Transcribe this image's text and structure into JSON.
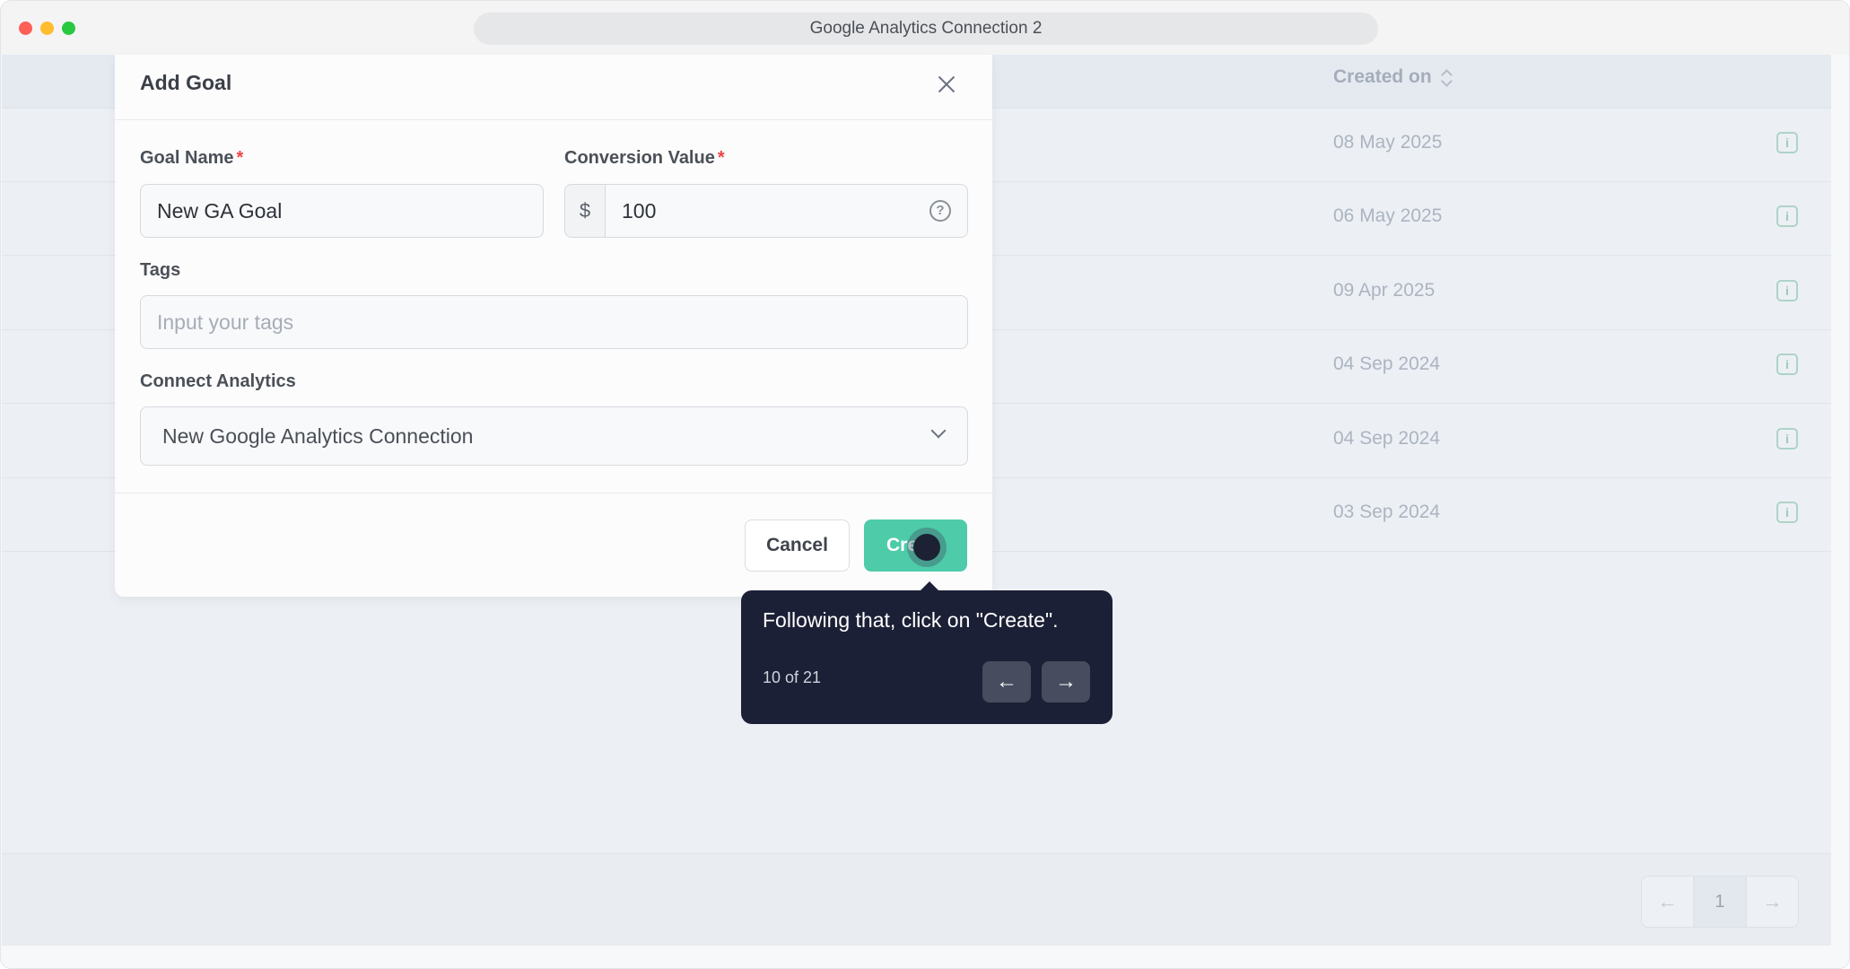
{
  "window": {
    "title": "Google Analytics Connection 2"
  },
  "table": {
    "created_header": "Created on",
    "rows": [
      {
        "date": "08 May 2025"
      },
      {
        "date": "06 May 2025"
      },
      {
        "date": "09 Apr 2025"
      },
      {
        "date": "04 Sep 2024"
      },
      {
        "date": "04 Sep 2024"
      },
      {
        "date": "03 Sep 2024"
      }
    ],
    "info_icon": "info-icon"
  },
  "pagination": {
    "prev": "←",
    "page": "1",
    "next": "→"
  },
  "modal": {
    "title": "Add Goal",
    "goal_name": {
      "label": "Goal Name",
      "required": "*",
      "value": "New GA Goal"
    },
    "conversion_value": {
      "label": "Conversion Value",
      "required": "*",
      "prefix": "$",
      "value": "100",
      "help_icon": "?"
    },
    "tags": {
      "label": "Tags",
      "placeholder": "Input your tags"
    },
    "connect_analytics": {
      "label": "Connect Analytics",
      "value": "New Google Analytics Connection"
    },
    "cancel_label": "Cancel",
    "create_label": "Cre"
  },
  "tooltip": {
    "text": "Following that, click on \"Create\".",
    "step": "10 of 21",
    "prev": "←",
    "next": "→"
  },
  "colors": {
    "accent": "#4ecba9",
    "tooltip_bg": "#1c2036",
    "required": "#ef4444"
  }
}
